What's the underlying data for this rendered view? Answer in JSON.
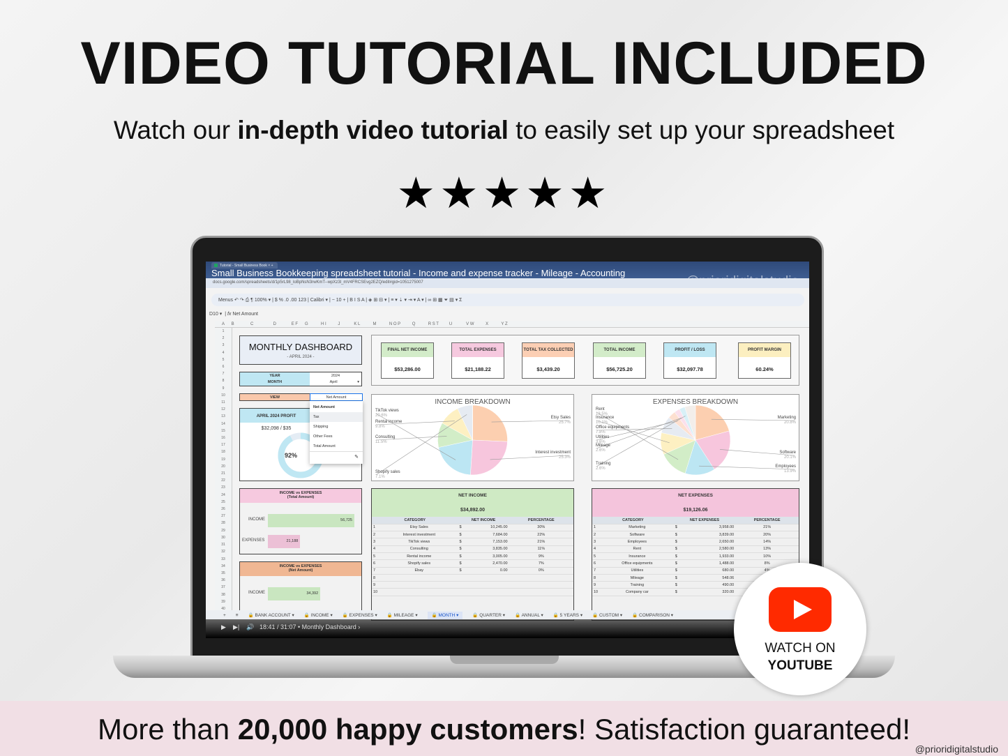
{
  "headline": "VIDEO TUTORIAL INCLUDED",
  "subtitle": {
    "pre": "Watch our ",
    "bold": "in-depth video tutorial",
    "post": " to easily set up your spreadsheet"
  },
  "rating": {
    "stars": 5,
    "glyph": "★★★★★"
  },
  "screen": {
    "window_title": "Small Business Bookkeeping spreadsheet tutorial - Income and expense tracker - Mileage - Accounting",
    "browser_tab": "Tutorial - Small Business Book",
    "url": "docs.google.com/spreadsheets/d/1p5rL98_loBpNsN3rwKmT--wpXz3l_mV4FRCSEvg2EZQ/edit#gid=1051275007",
    "watermark": "@prioridigitalstudio",
    "toolbar": "Menus   ↶  ↷  ⎙  ¶   100% ▾  |  $   %   .0   .00   123  |  Calibri ▾  |  −  10  +  |  B   I   S   A  |  ◈   ⊞   ⊟ ▾  |  ≡ ▾  ⇣ ▾  ⇥ ▾  A ▾  |  ∞   ⊞   ▦   ⏷   ▤ ▾   Σ",
    "cell_ref": "D10",
    "formula": "Net Amount",
    "columns": "A      B              C                 D             E F      G           H I          J            K L           M           N O P          Q           R S T         U            V W          X           Y Z",
    "dashboard": {
      "title": "MONTHLY DASHBOARD",
      "period": "- APRIL 2024 -",
      "year_label": "YEAR",
      "year": "2024",
      "month_label": "MONTH",
      "month": "April",
      "view_label": "VIEW",
      "view_value": "Net Amount",
      "view_options": [
        "Net Amount",
        "Tax",
        "Shipping",
        "Other Fees",
        "Total Amount"
      ],
      "profit_title": "APRIL 2024 PROFIT",
      "profit_value": "$32,098 / $35",
      "progress_pct": "92%",
      "progress": 0.92
    },
    "kpis": [
      {
        "label": "FINAL NET INCOME",
        "value": "$53,286.00",
        "color": "#d3ecc9"
      },
      {
        "label": "TOTAL EXPENSES",
        "value": "$21,188.22",
        "color": "#f6c9df"
      },
      {
        "label": "TOTAL TAX COLLECTED",
        "value": "$3,439.20",
        "color": "#fccfb4"
      },
      {
        "label": "TOTAL INCOME",
        "value": "$56,725.20",
        "color": "#d3ecc9"
      },
      {
        "label": "PROFIT / LOSS",
        "value": "$32,097.78",
        "color": "#bfe7f3"
      },
      {
        "label": "PROFIT MARGIN",
        "value": "60.24%",
        "color": "#fcefc0"
      }
    ],
    "income_vs_total": {
      "title": "INCOME vs EXPENSES",
      "subtitle": "(Total Amount)",
      "income_label": "INCOME",
      "income": "56,725",
      "income_value": 56725,
      "expenses_label": "EXPENSES",
      "expenses": "21,188",
      "expenses_value": 21188
    },
    "income_vs_net": {
      "title": "INCOME vs EXPENSES",
      "subtitle": "(Net Amount)",
      "income_label": "INCOME",
      "income": "34,392",
      "income_value": 34392
    },
    "net_income": {
      "title": "NET INCOME",
      "total": "$34,892.00",
      "headers": [
        "CATEGORY",
        "NET INCOME",
        "PERCENTAGE"
      ],
      "rows": [
        [
          "1",
          "Etsy Sales",
          "$",
          "10,245.00",
          "30%"
        ],
        [
          "2",
          "Interest investment",
          "$",
          "7,684.00",
          "22%"
        ],
        [
          "3",
          "TikTok views",
          "$",
          "7,153.00",
          "21%"
        ],
        [
          "4",
          "Consulting",
          "$",
          "3,835.00",
          "11%"
        ],
        [
          "5",
          "Rental income",
          "$",
          "3,005.00",
          "9%"
        ],
        [
          "6",
          "Shopify sales",
          "$",
          "2,470.00",
          "7%"
        ],
        [
          "7",
          "Ebay",
          "$",
          "0.00",
          "0%"
        ],
        [
          "8",
          "",
          "",
          "",
          ""
        ],
        [
          "9",
          "",
          "",
          "",
          ""
        ],
        [
          "10",
          "",
          "",
          "",
          ""
        ]
      ]
    },
    "net_expenses": {
      "title": "NET EXPENSES",
      "total": "$19,126.06",
      "headers": [
        "CATEGORY",
        "NET EXPENSES",
        "PERCENTAGE"
      ],
      "rows": [
        [
          "1",
          "Marketing",
          "$",
          "3,958.00",
          "21%"
        ],
        [
          "2",
          "Software",
          "$",
          "3,839.00",
          "20%"
        ],
        [
          "3",
          "Employees",
          "$",
          "2,650.00",
          "14%"
        ],
        [
          "4",
          "Rent",
          "$",
          "2,580.00",
          "13%"
        ],
        [
          "5",
          "Insurance",
          "$",
          "1,933.00",
          "10%"
        ],
        [
          "6",
          "Office equipments",
          "$",
          "1,488.00",
          "8%"
        ],
        [
          "7",
          "Utilities",
          "$",
          "680.00",
          "4%"
        ],
        [
          "8",
          "Mileage",
          "$",
          "548.06",
          ""
        ],
        [
          "9",
          "Training",
          "$",
          "490.00",
          ""
        ],
        [
          "10",
          "Company car",
          "$",
          "320.00",
          ""
        ]
      ]
    },
    "sheet_tabs": [
      "+",
      "≡",
      "🔒 BANK ACCOUNT ▾",
      "🔒 INCOME ▾",
      "🔒 EXPENSES ▾",
      "🔒 MILEAGE ▾",
      "🔒 MONTH ▾",
      "🔒 QUARTER ▾",
      "🔒 ANNUAL ▾",
      "🔒 5 YEARS ▾",
      "🔒 CUSTOM ▾",
      "🔒 COMPARISON ▾"
    ],
    "active_tab": 6,
    "video": {
      "time": "18:41 / 31:07",
      "chapter": "• Monthly Dashboard ›"
    }
  },
  "chart_data": [
    {
      "type": "pie",
      "title": "INCOME BREAKDOWN",
      "slices": [
        {
          "label": "Etsy Sales",
          "value": 25.7,
          "color": "#fccfb0"
        },
        {
          "label": "Interest investment",
          "value": 25.3,
          "color": "#f7c6dd"
        },
        {
          "label": "TikTok views",
          "value": 20.6,
          "color": "#bce6f3"
        },
        {
          "label": "Consulting",
          "value": 11.5,
          "color": "#d2edc7"
        },
        {
          "label": "Rental income",
          "value": 9.8,
          "color": "#fdf0c2"
        },
        {
          "label": "Shopify sales",
          "value": 7.1,
          "color": "#e6ebf2"
        }
      ]
    },
    {
      "type": "pie",
      "title": "EXPENSES BREAKDOWN",
      "slices": [
        {
          "label": "Marketing",
          "value": 20.8,
          "color": "#fccfb0"
        },
        {
          "label": "Software",
          "value": 20.1,
          "color": "#f7c6dd"
        },
        {
          "label": "Employees",
          "value": 13.9,
          "color": "#bce6f3"
        },
        {
          "label": "Rent",
          "value": 13.5,
          "color": "#d2edc7"
        },
        {
          "label": "Insurance",
          "value": 10.1,
          "color": "#fdf0c2"
        },
        {
          "label": "Office equipments",
          "value": 7.8,
          "color": "#e6ebf2"
        },
        {
          "label": "Utilities",
          "value": 3.6,
          "color": "#fde0d0"
        },
        {
          "label": "Mileage",
          "value": 2.6,
          "color": "#fbe0ec"
        },
        {
          "label": "Training",
          "value": 2.6,
          "color": "#d8f0f7"
        }
      ]
    }
  ],
  "youtube": {
    "line1": "WATCH ON",
    "line2": "YOUTUBE",
    "color": "#ff2a00"
  },
  "footer": {
    "pre": "More than ",
    "bold": "20,000 happy customers",
    "post": "! Satisfaction guaranteed!",
    "credit": "@prioridigitalstudio"
  }
}
